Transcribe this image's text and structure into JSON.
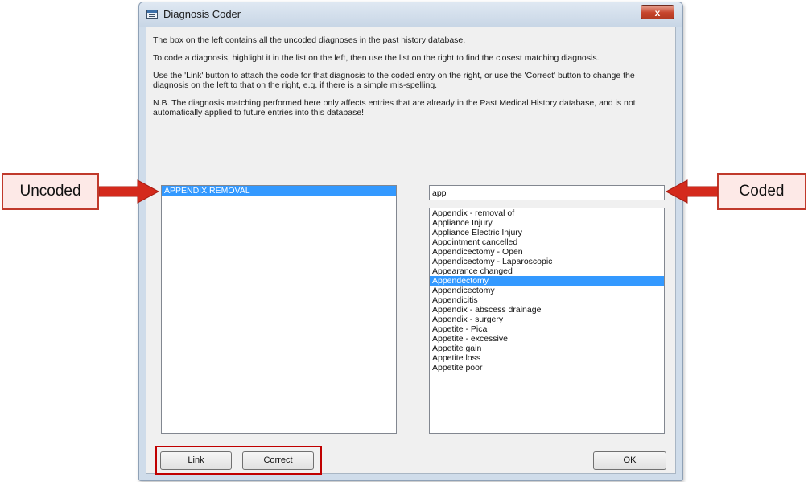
{
  "window": {
    "title": "Diagnosis Coder",
    "close_label": "x"
  },
  "instructions": [
    "The box on the left contains all the uncoded diagnoses in the past history database.",
    "To code a diagnosis, highlight it in the list on the left, then use the list on the right to find the closest matching diagnosis.",
    "Use the 'Link' button to attach the code for that diagnosis to the coded entry on the right, or use the 'Correct' button to change the diagnosis on the left to that on the right, e.g. if there is a simple mis-spelling.",
    "N.B. The diagnosis matching performed here only affects entries that are already in the Past Medical History database, and is not automatically applied to future entries into this database!"
  ],
  "uncoded_list": {
    "items": [
      "APPENDIX REMOVAL"
    ],
    "selected": "APPENDIX REMOVAL"
  },
  "search": {
    "value": "app"
  },
  "coded_list": {
    "items": [
      "Appendix - removal of",
      "Appliance Injury",
      "Appliance Electric Injury",
      "Appointment cancelled",
      "Appendicectomy - Open",
      "Appendicectomy - Laparoscopic",
      "Appearance changed",
      "Appendectomy",
      "Appendicectomy",
      "Appendicitis",
      "Appendix - abscess drainage",
      "Appendix - surgery",
      "Appetite - Pica",
      "Appetite - excessive",
      "Appetite gain",
      "Appetite loss",
      "Appetite poor"
    ],
    "selected": "Appendectomy"
  },
  "buttons": {
    "link": "Link",
    "correct": "Correct",
    "ok": "OK"
  },
  "callouts": {
    "uncoded": "Uncoded",
    "coded": "Coded"
  },
  "colors": {
    "selection": "#3399ff",
    "callout_border": "#c0392b",
    "callout_fill": "#fde9e7",
    "arrow": "#d42a1c"
  }
}
